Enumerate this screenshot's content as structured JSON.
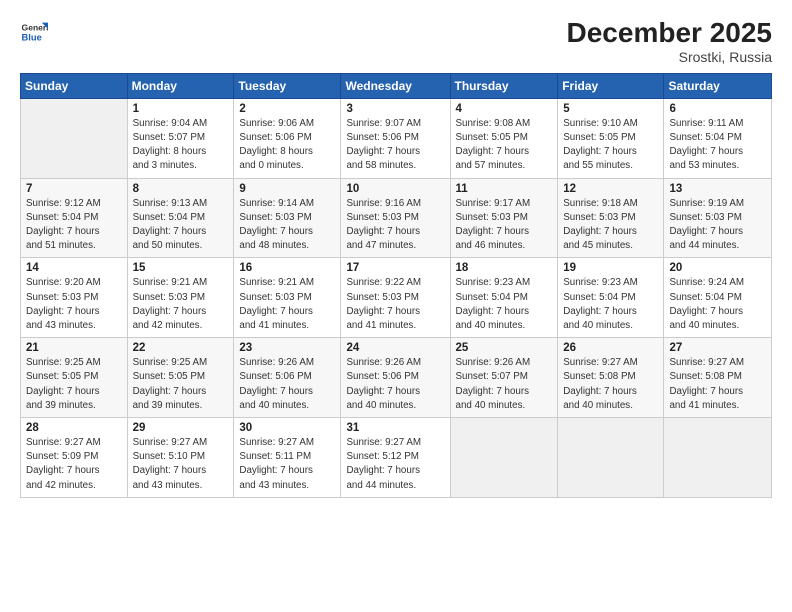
{
  "logo": {
    "line1": "General",
    "line2": "Blue"
  },
  "title": "December 2025",
  "location": "Srostki, Russia",
  "header": {
    "days": [
      "Sunday",
      "Monday",
      "Tuesday",
      "Wednesday",
      "Thursday",
      "Friday",
      "Saturday"
    ]
  },
  "weeks": [
    [
      {
        "day": "",
        "info": ""
      },
      {
        "day": "1",
        "info": "Sunrise: 9:04 AM\nSunset: 5:07 PM\nDaylight: 8 hours\nand 3 minutes."
      },
      {
        "day": "2",
        "info": "Sunrise: 9:06 AM\nSunset: 5:06 PM\nDaylight: 8 hours\nand 0 minutes."
      },
      {
        "day": "3",
        "info": "Sunrise: 9:07 AM\nSunset: 5:06 PM\nDaylight: 7 hours\nand 58 minutes."
      },
      {
        "day": "4",
        "info": "Sunrise: 9:08 AM\nSunset: 5:05 PM\nDaylight: 7 hours\nand 57 minutes."
      },
      {
        "day": "5",
        "info": "Sunrise: 9:10 AM\nSunset: 5:05 PM\nDaylight: 7 hours\nand 55 minutes."
      },
      {
        "day": "6",
        "info": "Sunrise: 9:11 AM\nSunset: 5:04 PM\nDaylight: 7 hours\nand 53 minutes."
      }
    ],
    [
      {
        "day": "7",
        "info": "Sunrise: 9:12 AM\nSunset: 5:04 PM\nDaylight: 7 hours\nand 51 minutes."
      },
      {
        "day": "8",
        "info": "Sunrise: 9:13 AM\nSunset: 5:04 PM\nDaylight: 7 hours\nand 50 minutes."
      },
      {
        "day": "9",
        "info": "Sunrise: 9:14 AM\nSunset: 5:03 PM\nDaylight: 7 hours\nand 48 minutes."
      },
      {
        "day": "10",
        "info": "Sunrise: 9:16 AM\nSunset: 5:03 PM\nDaylight: 7 hours\nand 47 minutes."
      },
      {
        "day": "11",
        "info": "Sunrise: 9:17 AM\nSunset: 5:03 PM\nDaylight: 7 hours\nand 46 minutes."
      },
      {
        "day": "12",
        "info": "Sunrise: 9:18 AM\nSunset: 5:03 PM\nDaylight: 7 hours\nand 45 minutes."
      },
      {
        "day": "13",
        "info": "Sunrise: 9:19 AM\nSunset: 5:03 PM\nDaylight: 7 hours\nand 44 minutes."
      }
    ],
    [
      {
        "day": "14",
        "info": "Sunrise: 9:20 AM\nSunset: 5:03 PM\nDaylight: 7 hours\nand 43 minutes."
      },
      {
        "day": "15",
        "info": "Sunrise: 9:21 AM\nSunset: 5:03 PM\nDaylight: 7 hours\nand 42 minutes."
      },
      {
        "day": "16",
        "info": "Sunrise: 9:21 AM\nSunset: 5:03 PM\nDaylight: 7 hours\nand 41 minutes."
      },
      {
        "day": "17",
        "info": "Sunrise: 9:22 AM\nSunset: 5:03 PM\nDaylight: 7 hours\nand 41 minutes."
      },
      {
        "day": "18",
        "info": "Sunrise: 9:23 AM\nSunset: 5:04 PM\nDaylight: 7 hours\nand 40 minutes."
      },
      {
        "day": "19",
        "info": "Sunrise: 9:23 AM\nSunset: 5:04 PM\nDaylight: 7 hours\nand 40 minutes."
      },
      {
        "day": "20",
        "info": "Sunrise: 9:24 AM\nSunset: 5:04 PM\nDaylight: 7 hours\nand 40 minutes."
      }
    ],
    [
      {
        "day": "21",
        "info": "Sunrise: 9:25 AM\nSunset: 5:05 PM\nDaylight: 7 hours\nand 39 minutes."
      },
      {
        "day": "22",
        "info": "Sunrise: 9:25 AM\nSunset: 5:05 PM\nDaylight: 7 hours\nand 39 minutes."
      },
      {
        "day": "23",
        "info": "Sunrise: 9:26 AM\nSunset: 5:06 PM\nDaylight: 7 hours\nand 40 minutes."
      },
      {
        "day": "24",
        "info": "Sunrise: 9:26 AM\nSunset: 5:06 PM\nDaylight: 7 hours\nand 40 minutes."
      },
      {
        "day": "25",
        "info": "Sunrise: 9:26 AM\nSunset: 5:07 PM\nDaylight: 7 hours\nand 40 minutes."
      },
      {
        "day": "26",
        "info": "Sunrise: 9:27 AM\nSunset: 5:08 PM\nDaylight: 7 hours\nand 40 minutes."
      },
      {
        "day": "27",
        "info": "Sunrise: 9:27 AM\nSunset: 5:08 PM\nDaylight: 7 hours\nand 41 minutes."
      }
    ],
    [
      {
        "day": "28",
        "info": "Sunrise: 9:27 AM\nSunset: 5:09 PM\nDaylight: 7 hours\nand 42 minutes."
      },
      {
        "day": "29",
        "info": "Sunrise: 9:27 AM\nSunset: 5:10 PM\nDaylight: 7 hours\nand 43 minutes."
      },
      {
        "day": "30",
        "info": "Sunrise: 9:27 AM\nSunset: 5:11 PM\nDaylight: 7 hours\nand 43 minutes."
      },
      {
        "day": "31",
        "info": "Sunrise: 9:27 AM\nSunset: 5:12 PM\nDaylight: 7 hours\nand 44 minutes."
      },
      {
        "day": "",
        "info": ""
      },
      {
        "day": "",
        "info": ""
      },
      {
        "day": "",
        "info": ""
      }
    ]
  ]
}
